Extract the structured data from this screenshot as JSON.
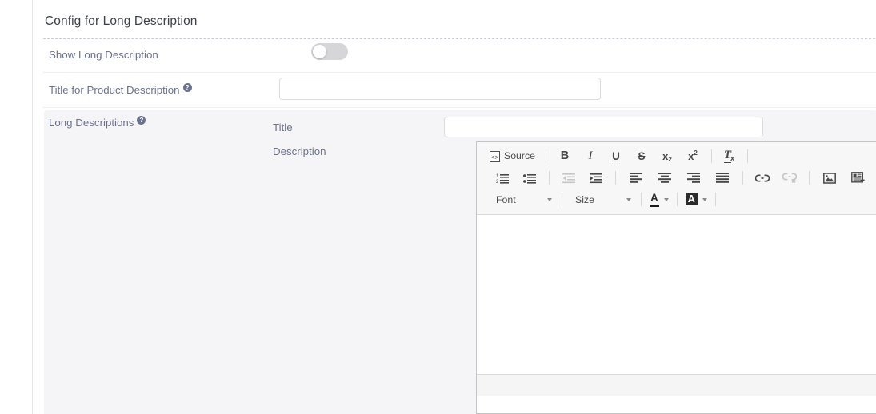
{
  "section": {
    "title": "Config for Long Description"
  },
  "fields": {
    "show_long_description": {
      "label": "Show Long Description",
      "toggle_state": "off"
    },
    "title_for_product_description": {
      "label": "Title for Product Description",
      "help_glyph": "?",
      "value": "",
      "placeholder": ""
    },
    "long_descriptions": {
      "label": "Long Descriptions",
      "help_glyph": "?"
    }
  },
  "subfields": {
    "title": {
      "label": "Title",
      "value": "",
      "placeholder": ""
    },
    "description": {
      "label": "Description"
    }
  },
  "editor": {
    "source_label": "Source",
    "font_label": "Font",
    "size_label": "Size",
    "content": "",
    "toolbar_row1": [
      {
        "name": "source-button",
        "label": "Source",
        "enabled": true
      },
      {
        "name": "bold-icon",
        "label": "B",
        "enabled": true
      },
      {
        "name": "italic-icon",
        "label": "I",
        "enabled": true
      },
      {
        "name": "underline-icon",
        "label": "U",
        "enabled": true
      },
      {
        "name": "strikethrough-icon",
        "label": "S",
        "enabled": true
      },
      {
        "name": "subscript-icon",
        "label": "x₂",
        "enabled": true
      },
      {
        "name": "superscript-icon",
        "label": "x²",
        "enabled": true
      },
      {
        "name": "remove-format-icon",
        "label": "Tx",
        "enabled": true
      }
    ],
    "toolbar_row2": [
      {
        "name": "numbered-list-icon",
        "enabled": true
      },
      {
        "name": "bulleted-list-icon",
        "enabled": true
      },
      {
        "name": "outdent-icon",
        "enabled": false
      },
      {
        "name": "indent-icon",
        "enabled": true
      },
      {
        "name": "align-left-icon",
        "enabled": true
      },
      {
        "name": "align-center-icon",
        "enabled": true
      },
      {
        "name": "align-right-icon",
        "enabled": true
      },
      {
        "name": "justify-icon",
        "enabled": true
      },
      {
        "name": "link-icon",
        "enabled": true
      },
      {
        "name": "unlink-icon",
        "enabled": false
      },
      {
        "name": "image-icon",
        "enabled": true
      },
      {
        "name": "template-icon",
        "enabled": true
      }
    ],
    "toolbar_row3": [
      {
        "name": "font-dropdown",
        "label": "Font"
      },
      {
        "name": "size-dropdown",
        "label": "Size"
      },
      {
        "name": "text-color-icon",
        "label": "A"
      },
      {
        "name": "background-color-icon",
        "label": "A"
      }
    ]
  },
  "colors": {
    "label_text": "#6b7290",
    "title_text": "#3b3f4a",
    "panel_bg": "#f5f5f7",
    "toggle_off": "#d6d6d9",
    "toolbar_bg": "#f7f7f7",
    "border": "#c4c4c4"
  }
}
